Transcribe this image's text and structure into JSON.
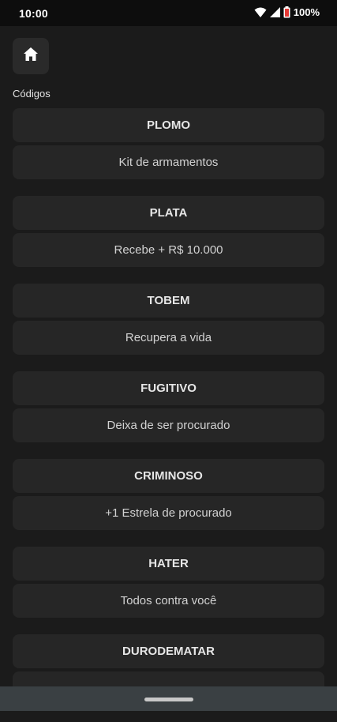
{
  "status": {
    "time": "10:00",
    "battery": "100%",
    "icons": [
      "wifi-icon",
      "signal-icon",
      "battery-icon"
    ]
  },
  "header": {
    "home_icon": "home-icon"
  },
  "section_label": "Códigos",
  "codes": [
    {
      "code": "PLOMO",
      "description": "Kit de armamentos"
    },
    {
      "code": "PLATA",
      "description": "Recebe + R$ 10.000"
    },
    {
      "code": "TOBEM",
      "description": "Recupera a vida"
    },
    {
      "code": "FUGITIVO",
      "description": "Deixa de ser procurado"
    },
    {
      "code": "CRIMINOSO",
      "description": "+1 Estrela de procurado"
    },
    {
      "code": "HATER",
      "description": "Todos contra você"
    },
    {
      "code": "DURODEMATAR",
      "description": ""
    }
  ],
  "colors": {
    "background": "#1b1b1b",
    "card": "#262626",
    "battery_accent": "#e53935"
  }
}
